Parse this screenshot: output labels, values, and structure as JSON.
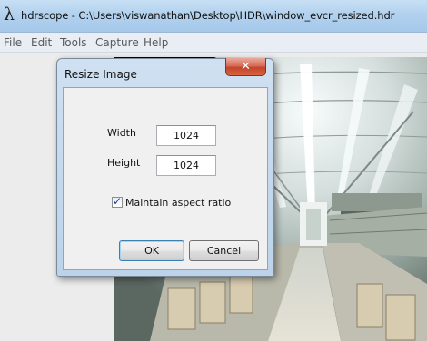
{
  "window": {
    "app_icon": "λ",
    "title": "hdrscope - C:\\Users\\viswanathan\\Desktop\\HDR\\window_evcr_resized.hdr"
  },
  "menu": [
    "File",
    "Edit",
    "Tools",
    "Capture",
    "Help"
  ],
  "dialog": {
    "title": "Resize Image",
    "close_glyph": "✕",
    "width_label": "Width",
    "width_value": "1024",
    "height_label": "Height",
    "height_value": "1024",
    "maintain_aspect_label": "Maintain aspect ratio",
    "maintain_aspect_checked": true,
    "check_glyph": "✓",
    "ok_label": "OK",
    "cancel_label": "Cancel"
  },
  "icons": {
    "app": "lambda-icon",
    "close": "close-icon",
    "check": "checkmark-icon"
  },
  "colors": {
    "titlebar": "#b2d1ee",
    "menubar": "#e9eef5",
    "dialog_frame": "#bcd3ea",
    "close_button": "#c4442c",
    "default_button_border": "#3c7fb1"
  }
}
